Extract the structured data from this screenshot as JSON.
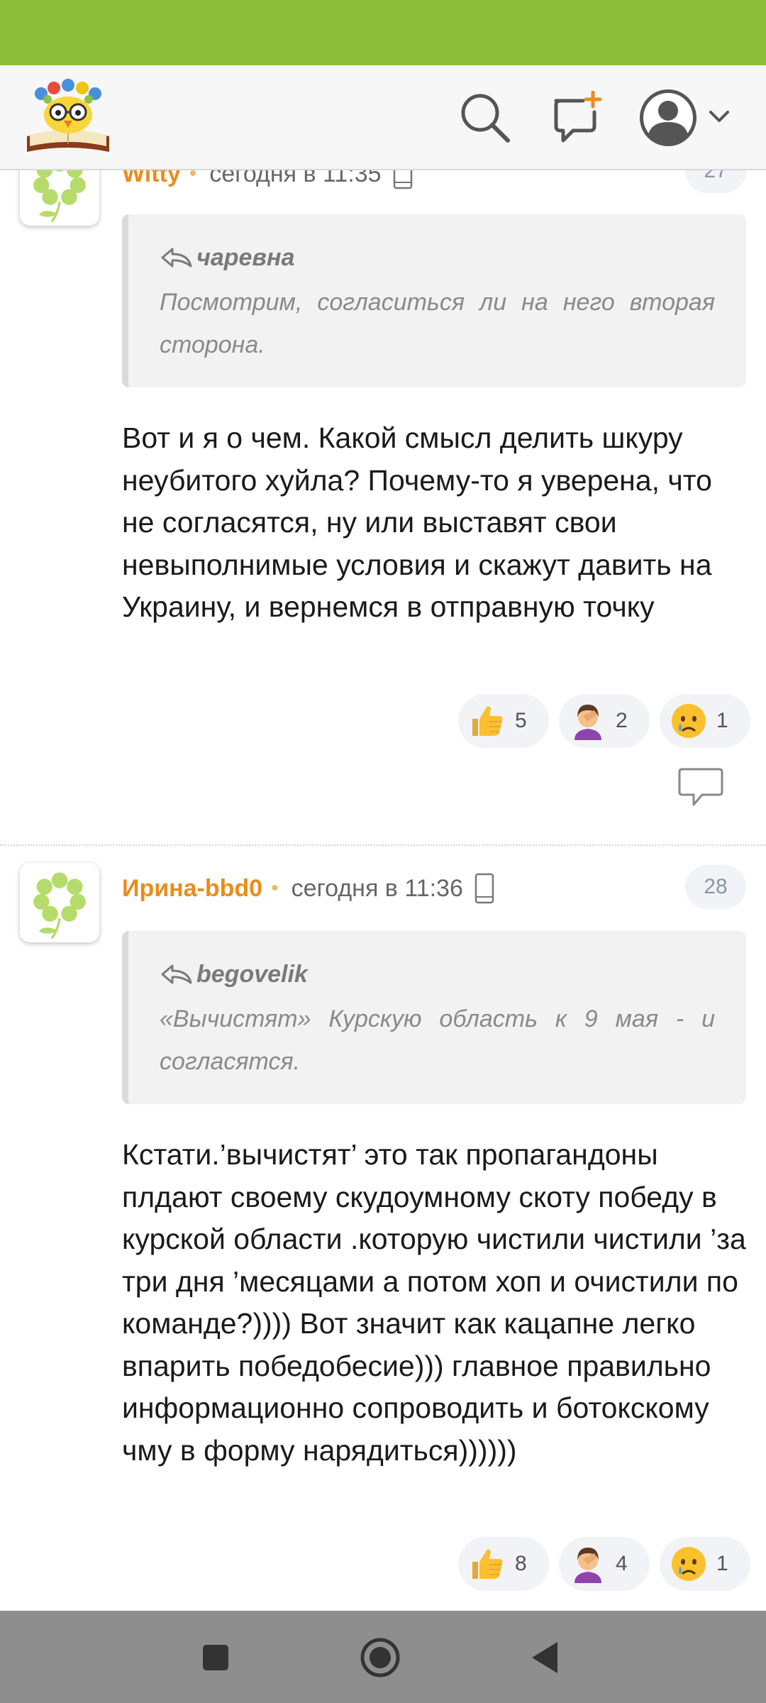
{
  "colors": {
    "status_bar": "#8bbd3b",
    "author": "#ea8c1a",
    "nav_bar": "#8e8e8e",
    "header_bg": "#f7f7f7"
  },
  "header": {
    "logo_icon": "owl-book-logo-icon",
    "search_icon": "search-icon",
    "new_post_icon": "new-post-bubble-icon",
    "profile_icon": "user-avatar-icon",
    "dropdown_icon": "chevron-down-icon"
  },
  "comments": [
    {
      "author": "Witty",
      "time": "сегодня в 11:35",
      "number": "27",
      "quote_author": "чаревна",
      "quote_text": "Посмотрим, согласиться ли на него вторая сторона.",
      "text": "Вот и я о чем. Какой смысл делить шкуру неубитого хуйла? Почему-то я уверена, что не согласятся, ну или выставят свои невыполнимые условия и скажут давить на Украину, и вернемся в отправную точку",
      "reactions": [
        {
          "icon": "thumbs-up-icon",
          "count": "5"
        },
        {
          "icon": "facepalm-icon",
          "count": "2"
        },
        {
          "icon": "crying-face-icon",
          "count": "1"
        }
      ]
    },
    {
      "author": "Ирина-bbd0",
      "time": "сегодня в 11:36",
      "number": "28",
      "quote_author": "begovelik",
      "quote_text": "«Вычистят» Курскую область к 9 мая - и согласятся.",
      "text": "Кстати.’вычистят’ это так пропагандоны плдают своему скудоумному скоту победу в курской области .которую чистили чистили ’за три дня ’месяцами а потом хоп и очистили по команде?)))) Вот значит как кацапне легко впарить победобесие))) главное правильно информационно сопроводить и ботокскому чму в форму нарядиться))))))",
      "reactions": [
        {
          "icon": "thumbs-up-icon",
          "count": "8"
        },
        {
          "icon": "facepalm-icon",
          "count": "4"
        },
        {
          "icon": "crying-face-icon",
          "count": "1"
        }
      ]
    }
  ],
  "nav": {
    "recents_icon": "square-recents-icon",
    "home_icon": "circle-home-icon",
    "back_icon": "triangle-back-icon"
  }
}
